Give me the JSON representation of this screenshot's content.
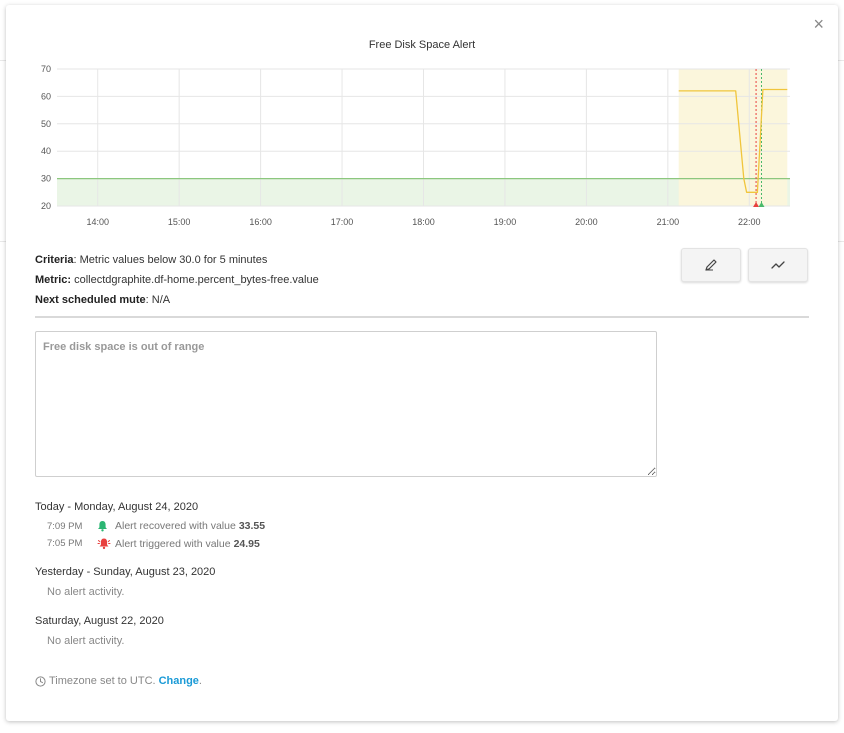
{
  "modal": {
    "close_label": "×",
    "chart_title": "Free Disk Space Alert"
  },
  "chart_data": {
    "type": "line",
    "title": "Free Disk Space Alert",
    "xlabel": "",
    "ylabel": "",
    "x_ticks": [
      "14:00",
      "15:00",
      "16:00",
      "17:00",
      "18:00",
      "19:00",
      "20:00",
      "21:00",
      "22:00"
    ],
    "y_ticks": [
      20,
      30,
      40,
      50,
      60,
      70
    ],
    "xlim": [
      "13:30",
      "22:30"
    ],
    "ylim": [
      20,
      70
    ],
    "threshold": 30,
    "grid": true,
    "series": [
      {
        "color": "#f0c53c",
        "points": [
          [
            "21:08",
            62
          ],
          [
            "21:50",
            62
          ],
          [
            "21:56",
            30
          ],
          [
            "21:58",
            25
          ],
          [
            "22:06",
            25
          ],
          [
            "22:10",
            62.5
          ],
          [
            "22:28",
            62.5
          ]
        ]
      }
    ],
    "highlight_region": {
      "from": "21:08",
      "to": "22:28",
      "color": "#fbf6dc"
    },
    "threshold_region_color": "#eaf5e6",
    "threshold_line_color": "#8cc77e",
    "event_markers": [
      {
        "time": "22:05",
        "color": "#e8403e"
      },
      {
        "time": "22:09",
        "color": "#4ab96a"
      }
    ]
  },
  "criteria": {
    "label": "Criteria",
    "value": ": Metric values below 30.0 for 5 minutes"
  },
  "metric": {
    "label": "Metric:",
    "value": " collectdgraphite.df-home.percent_bytes-free.value"
  },
  "next_mute": {
    "label": "Next scheduled mute",
    "value": ": N/A"
  },
  "buttons": {
    "edit_icon": "pencil-icon",
    "graph_icon": "trend-line-icon"
  },
  "notes": {
    "placeholder": "Free disk space is out of range"
  },
  "history": [
    {
      "heading": "Today - Monday, August 24, 2020",
      "events": [
        {
          "time": "7:09 PM",
          "icon": "bell-icon",
          "color": "#2bb673",
          "text": "Alert recovered with value",
          "value": "33.55"
        },
        {
          "time": "7:05 PM",
          "icon": "bell-ringing-icon",
          "color": "#e8403e",
          "text": "Alert triggered with value",
          "value": "24.95"
        }
      ]
    },
    {
      "heading": "Yesterday - Sunday, August 23, 2020",
      "empty": "No alert activity."
    },
    {
      "heading": "Saturday, August 22, 2020",
      "empty": "No alert activity."
    }
  ],
  "timezone": {
    "text": "Timezone set to UTC.",
    "link": "Change",
    "suffix": "."
  }
}
